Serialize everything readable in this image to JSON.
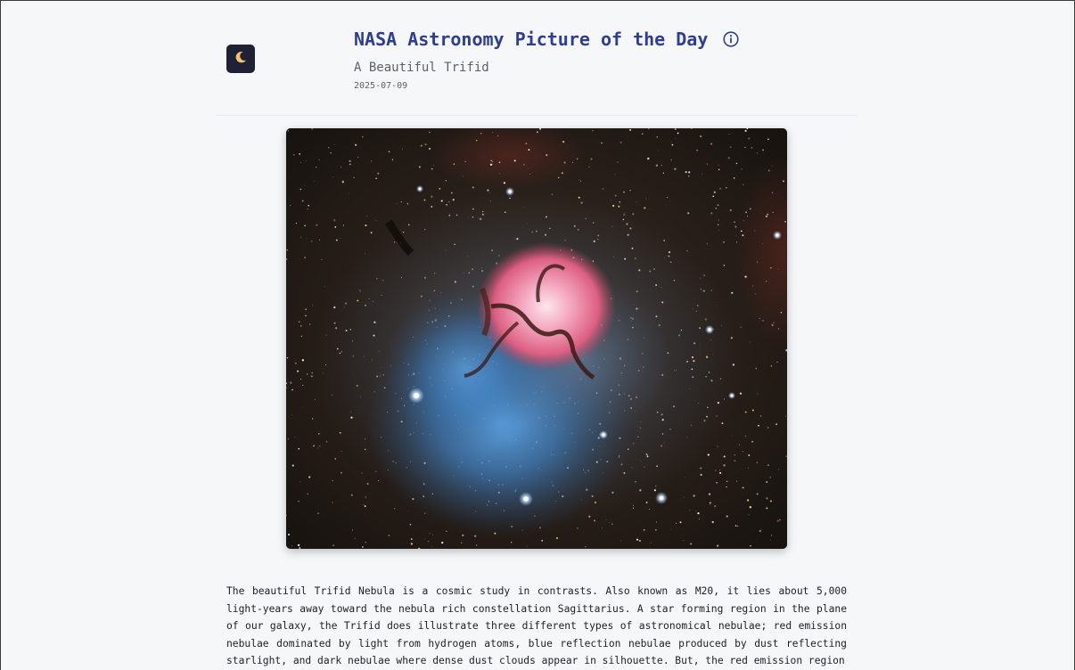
{
  "header": {
    "title": "NASA Astronomy Picture of the Day",
    "subtitle": "A Beautiful Trifid",
    "date": "2025-07-09"
  },
  "icons": {
    "app": "moon-icon",
    "info": "info-icon"
  },
  "image": {
    "subject": "Trifid Nebula (M20)"
  },
  "explanation": "The beautiful Trifid Nebula is a cosmic study in contrasts. Also known as M20, it lies about 5,000 light-years away toward the nebula rich constellation Sagittarius. A star forming region in the plane of our galaxy, the Trifid does illustrate three different types of astronomical nebulae; red emission nebulae dominated by light from hydrogen atoms, blue reflection nebulae produced by dust reflecting starlight, and dark nebulae where dense dust clouds appear in silhouette. But, the red emission region",
  "colors": {
    "title": "#2e3d96",
    "background": "#f6f7f9",
    "app_icon_bg": "#1f2137",
    "moon": "#f5c26b"
  }
}
